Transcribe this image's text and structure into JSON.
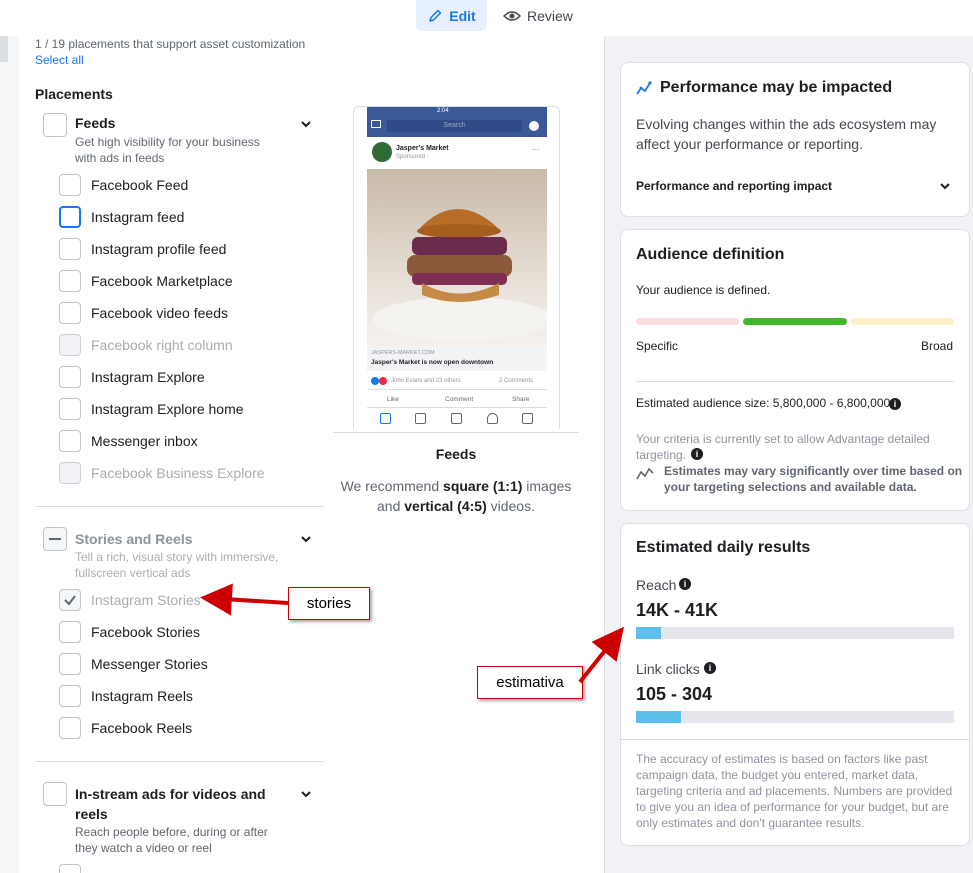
{
  "tabs": {
    "edit": "Edit",
    "review": "Review"
  },
  "left": {
    "summary": "1 / 19 placements that support asset customization",
    "select_all": "Select all",
    "placements_heading": "Placements",
    "feeds": {
      "title": "Feeds",
      "desc1": "Get high visibility for your business",
      "desc2": "with ads in feeds",
      "items": [
        "Facebook Feed",
        "Instagram feed",
        "Instagram profile feed",
        "Facebook Marketplace",
        "Facebook video feeds",
        "Facebook right column",
        "Instagram Explore",
        "Instagram Explore home",
        "Messenger inbox",
        "Facebook Business Explore"
      ]
    },
    "stories": {
      "title": "Stories and Reels",
      "desc1": "Tell a rich, visual story with immersive,",
      "desc2": "fullscreen vertical ads",
      "items": [
        "Instagram Stories",
        "Facebook Stories",
        "Messenger Stories",
        "Instagram Reels",
        "Facebook Reels"
      ]
    },
    "instream": {
      "title1": "In-stream ads for videos and",
      "title2": "reels",
      "desc1": "Reach people before, during or after",
      "desc2": "they watch a video or reel"
    },
    "preview": {
      "status_time": "2:04",
      "search": "Search",
      "page_name": "Jasper's Market",
      "sponsored": "Sponsored · ",
      "link_url": "JASPERS-MARKET.COM",
      "link_title": "Jasper's Market is now open downtown",
      "reactions": "John Evans and 23 others",
      "comments": "2 Comments",
      "like": "Like",
      "comment": "Comment",
      "share": "Share",
      "caption_title": "Feeds",
      "rec_1a": "We recommend ",
      "rec_1b": "square (1:1)",
      "rec_1c": " images",
      "rec_2a": "and ",
      "rec_2b": "vertical (4:5)",
      "rec_2c": " videos."
    }
  },
  "right": {
    "perf": {
      "title": "Performance may be impacted",
      "body1": "Evolving changes within the ads ecosystem may",
      "body2": "affect your performance or reporting.",
      "link": "Performance and reporting impact"
    },
    "audience": {
      "title": "Audience definition",
      "status": "Your audience is defined.",
      "specific": "Specific",
      "broad": "Broad",
      "size": "Estimated audience size: 5,800,000 - 6,800,000",
      "criteria1": "Your criteria is currently set to allow Advantage detailed",
      "criteria2": "targeting.",
      "note1": "Estimates may vary significantly over time based on",
      "note2": "your targeting selections and available data."
    },
    "results": {
      "title": "Estimated daily results",
      "reach_label": "Reach",
      "reach_value": "14K - 41K",
      "reach_fill": 0.08,
      "clicks_label": "Link clicks",
      "clicks_value": "105 - 304",
      "clicks_fill": 0.14,
      "disclaimer": [
        "The accuracy of estimates is based on factors like past",
        "campaign data, the budget you entered, market data,",
        "targeting criteria and ad placements. Numbers are provided",
        "to give you an idea of performance for your budget, but are",
        "only estimates and don't guarantee results."
      ]
    }
  },
  "annotations": {
    "stories": "stories",
    "estimativa": "estimativa"
  },
  "colors": {
    "accent": "#1877f2",
    "bar_fill": "#5bc0eb",
    "green": "#42b72a",
    "annotation": "#cc0000"
  }
}
